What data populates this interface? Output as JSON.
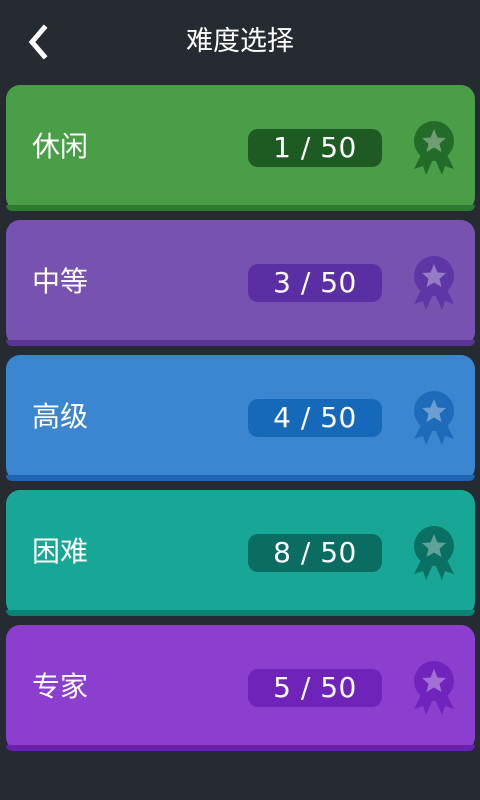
{
  "header": {
    "back_icon": "chevron-left-icon",
    "title": "难度选择"
  },
  "levels": [
    {
      "label": "休闲",
      "progress": "1 / 50",
      "badge_icon": "star-medal-icon",
      "color": "#4a9e47",
      "shadow": "#2d7a31",
      "pill": "#1e5b22",
      "badge": "#236b28"
    },
    {
      "label": "中等",
      "progress": "3 / 50",
      "badge_icon": "star-medal-icon",
      "color": "#7852b0",
      "shadow": "#5a3592",
      "pill": "#5b2fa3",
      "badge": "#5e36a6"
    },
    {
      "label": "高级",
      "progress": "4 / 50",
      "badge_icon": "star-medal-icon",
      "color": "#3b86d1",
      "shadow": "#1e64b2",
      "pill": "#1668b8",
      "badge": "#1e6abb"
    },
    {
      "label": "困难",
      "progress": "8 / 50",
      "badge_icon": "star-medal-icon",
      "color": "#18a796",
      "shadow": "#0a8374",
      "pill": "#0b6d62",
      "badge": "#0a7064"
    },
    {
      "label": "专家",
      "progress": "5 / 50",
      "badge_icon": "star-medal-icon",
      "color": "#8c3fcf",
      "shadow": "#6a1fb0",
      "pill": "#6f23b8",
      "badge": "#7024bd"
    }
  ]
}
